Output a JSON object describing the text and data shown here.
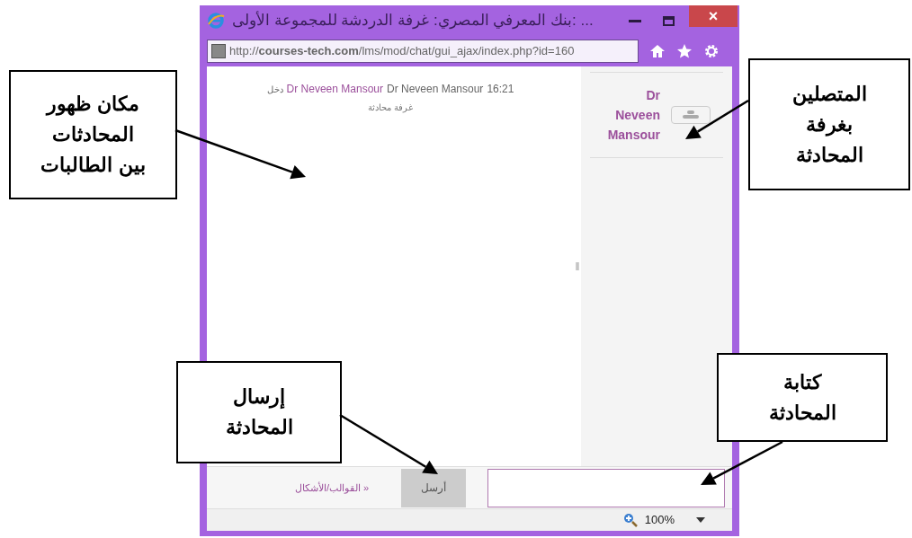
{
  "window": {
    "title": "... :بنك المعرفي المصري: غرفة الدردشة للمجموعة الأولى",
    "close_label": "×"
  },
  "address_bar": {
    "url": "http://**courses-tech.com**/lms/mod/chat/gui_ajax/index.php?id=160"
  },
  "messages": [
    {
      "time": "16:21",
      "user": "Dr Neveen Mansour",
      "link": "Dr Neveen Mansour",
      "action": "دخل",
      "room": "غرفة محادثة"
    }
  ],
  "users": [
    {
      "name": "Dr Neveen Mansour"
    }
  ],
  "splitter": "‖",
  "composer": {
    "send_button": "أرسل",
    "templates_link": "القوالب/الأشكال »"
  },
  "status_bar": {
    "zoom": "100%"
  },
  "callouts": [
    {
      "text": "مكان ظهور\nالمحادثات\nبين الطالبات"
    },
    {
      "text": "المتصلين\nبغرفة\nالمحادثة"
    },
    {
      "text": "إرسال\nالمحادثة"
    },
    {
      "text": "كتابة\nالمحادثة"
    }
  ]
}
